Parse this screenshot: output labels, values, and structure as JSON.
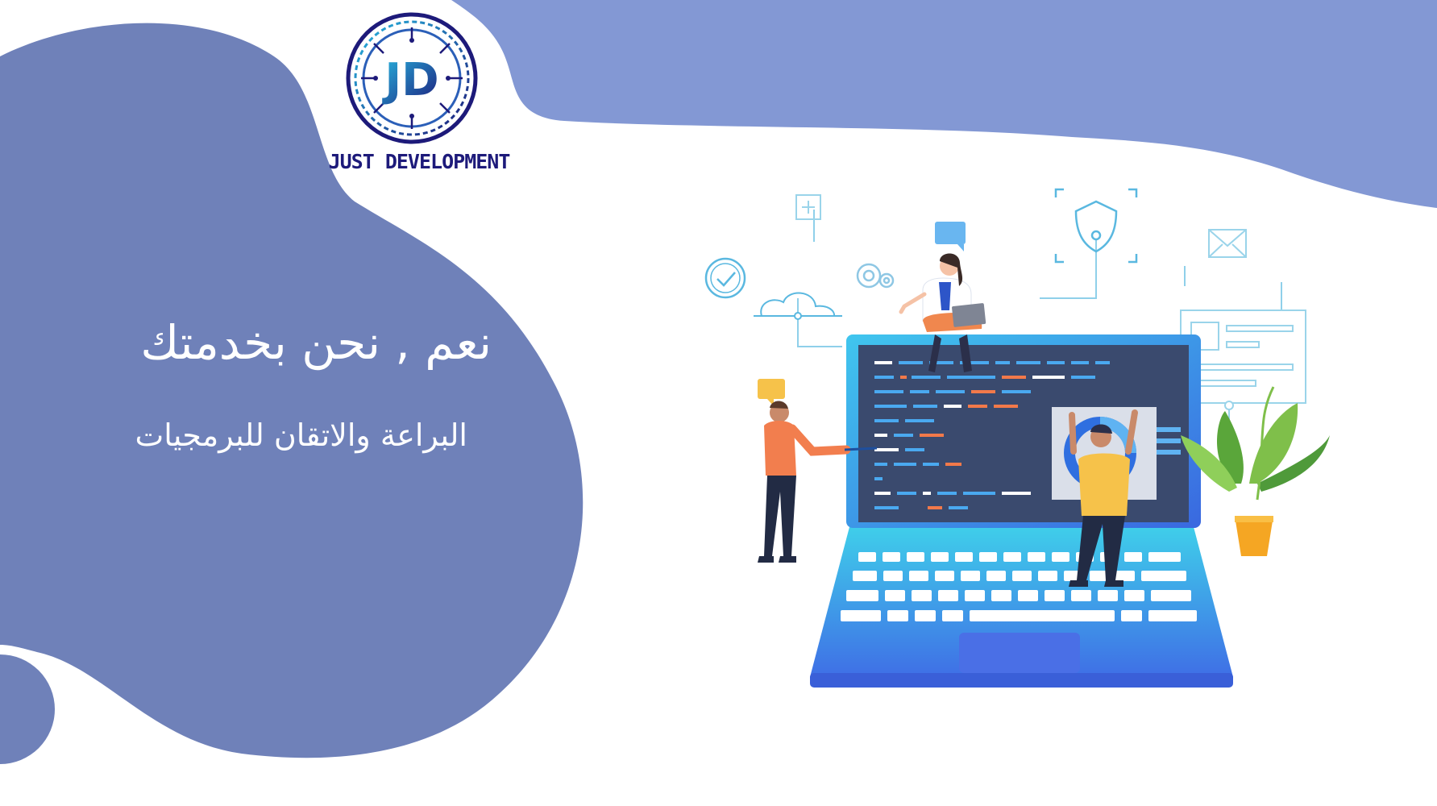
{
  "brand": {
    "name": "JUST DEVELOPMENT",
    "monogram": "JD",
    "colors": {
      "navy": "#1d1a7a",
      "blue": "#3a7fd6",
      "cyan": "#27b7e0"
    }
  },
  "hero": {
    "headline": "نعم , نحن بخدمتك",
    "subline": "البراعة والاتقان للبرمجيات"
  },
  "palette": {
    "blob_left": "#6f81b9",
    "blob_top": "#8398d4",
    "background": "#ffffff"
  },
  "illustration": {
    "icons": [
      "plus-icon",
      "check-icon",
      "cloud-icon",
      "gear-icon",
      "chat-bubble-icon",
      "shield-icon",
      "mail-icon",
      "document-icon",
      "donut-chart-icon",
      "plant-icon"
    ]
  }
}
